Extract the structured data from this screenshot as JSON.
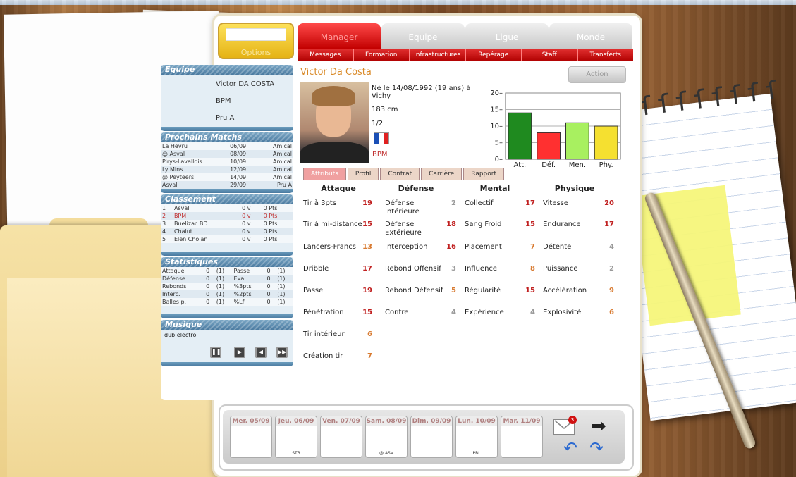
{
  "options_label": "Options",
  "nav": {
    "tabs": [
      "Manager",
      "Equipe",
      "Ligue",
      "Monde"
    ],
    "subtabs": [
      "Messages",
      "Formation",
      "Infrastructures",
      "Repérage",
      "Staff",
      "Transferts"
    ]
  },
  "sidebar": {
    "equipe": {
      "title": "Equipe",
      "lines": [
        "Victor DA COSTA",
        "BPM",
        "Pru A"
      ]
    },
    "matchs": {
      "title": "Prochains Matchs",
      "rows": [
        [
          "La Hevru",
          "06/09",
          "Amical"
        ],
        [
          "@ Asval",
          "08/09",
          "Amical"
        ],
        [
          "Pirys-Lavallois",
          "10/09",
          "Amical"
        ],
        [
          "Ly Mins",
          "12/09",
          "Amical"
        ],
        [
          "@ Peyteers",
          "14/09",
          "Amical"
        ],
        [
          "Asval",
          "29/09",
          "Pru A"
        ]
      ]
    },
    "classement": {
      "title": "Classement",
      "rows": [
        [
          "1",
          "Asval",
          "0 v",
          "0 Pts"
        ],
        [
          "2",
          "BPM",
          "0 v",
          "0 Pts"
        ],
        [
          "3",
          "Buelizac BD",
          "0 v",
          "0 Pts"
        ],
        [
          "4",
          "Chalut",
          "0 v",
          "0 Pts"
        ],
        [
          "5",
          "Elen Cholan",
          "0 v",
          "0 Pts"
        ]
      ]
    },
    "stats": {
      "title": "Statistiques",
      "rows": [
        [
          "Attaque",
          "0",
          "(1)",
          "Passe",
          "0",
          "(1)"
        ],
        [
          "Défense",
          "0",
          "(1)",
          "Eval.",
          "0",
          "(1)"
        ],
        [
          "Rebonds",
          "0",
          "(1)",
          "%3pts",
          "0",
          "(1)"
        ],
        [
          "Interc.",
          "0",
          "(1)",
          "%2pts",
          "0",
          "(1)"
        ],
        [
          "Balles p.",
          "0",
          "(1)",
          "%Lf",
          "0",
          "(1)"
        ]
      ]
    },
    "musique": {
      "title": "Musique",
      "track": "dub electro"
    }
  },
  "player": {
    "name": "Victor Da Costa",
    "action": "Action",
    "born": "Né le 14/08/1992 (19  ans) à Vichy",
    "height": "183 cm",
    "ratio": "1/2",
    "club": "BPM"
  },
  "attr_tabs": [
    "Attributs",
    "Profil",
    "Contrat",
    "Carrière",
    "Rapport"
  ],
  "attr_headers": [
    "Attaque",
    "Défense",
    "Mental",
    "Physique"
  ],
  "attributes": {
    "attaque": [
      [
        "Tir à 3pts",
        "19"
      ],
      [
        "Tir à mi-distance",
        "15"
      ],
      [
        "Lancers-Francs",
        "13"
      ],
      [
        "Dribble",
        "17"
      ],
      [
        "Passe",
        "19"
      ],
      [
        "Pénétration",
        "15"
      ],
      [
        "Tir intérieur",
        "6"
      ],
      [
        "Création tir",
        "7"
      ]
    ],
    "defense": [
      [
        "Défense Intérieure",
        "2"
      ],
      [
        "Défense Extérieure",
        "18"
      ],
      [
        "Interception",
        "16"
      ],
      [
        "Rebond Offensif",
        "3"
      ],
      [
        "Rebond Défensif",
        "5"
      ],
      [
        "Contre",
        "4"
      ]
    ],
    "mental": [
      [
        "Collectif",
        "17"
      ],
      [
        "Sang Froid",
        "15"
      ],
      [
        "Placement",
        "7"
      ],
      [
        "Influence",
        "8"
      ],
      [
        "Régularité",
        "15"
      ],
      [
        "Expérience",
        "4"
      ]
    ],
    "physique": [
      [
        "Vitesse",
        "20"
      ],
      [
        "Endurance",
        "17"
      ],
      [
        "Détente",
        "4"
      ],
      [
        "Puissance",
        "2"
      ],
      [
        "Accélération",
        "9"
      ],
      [
        "Explosivité",
        "6"
      ]
    ]
  },
  "chart_data": {
    "type": "bar",
    "categories": [
      "Att.",
      "Déf.",
      "Men.",
      "Phy."
    ],
    "values": [
      14,
      8,
      11,
      10
    ],
    "yticks": [
      "0",
      "5",
      "10",
      "15",
      "20"
    ],
    "ylim": [
      0,
      20
    ],
    "colors": [
      "#1f8a1f",
      "#ff3030",
      "#a8f060",
      "#f5e030"
    ]
  },
  "calendar": [
    [
      "Mer. 05/09",
      ""
    ],
    [
      "Jeu. 06/09",
      "STB"
    ],
    [
      "Ven. 07/09",
      ""
    ],
    [
      "Sam. 08/09",
      "@ ASV"
    ],
    [
      "Dim. 09/09",
      ""
    ],
    [
      "Lun. 10/09",
      "PBL"
    ],
    [
      "Mar. 11/09",
      ""
    ]
  ],
  "mail_count": "3"
}
